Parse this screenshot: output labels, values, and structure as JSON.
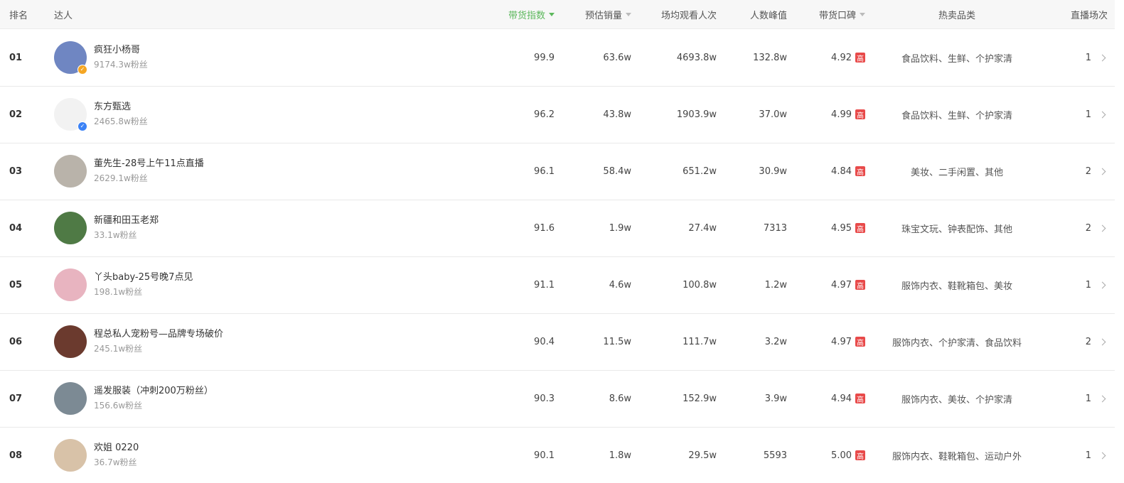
{
  "header": {
    "rank": "排名",
    "talent": "达人",
    "index": "带货指数",
    "sales": "预估销量",
    "views": "场均观看人次",
    "peak": "人数峰值",
    "reputation": "带货口碑",
    "categories": "热卖品类",
    "sessions": "直播场次"
  },
  "high_label": "高",
  "rows": [
    {
      "rank": "01",
      "name": "疯狂小杨哥",
      "fans": "9174.3w粉丝",
      "index": "99.9",
      "sales": "63.6w",
      "views": "4693.8w",
      "peak": "132.8w",
      "reputation": "4.92",
      "categories": "食品饮料、生鲜、个护家清",
      "sessions": "1",
      "avatar_color": "#6f86c2",
      "badge_color": "#f5a623"
    },
    {
      "rank": "02",
      "name": "东方甄选",
      "fans": "2465.8w粉丝",
      "index": "96.2",
      "sales": "43.8w",
      "views": "1903.9w",
      "peak": "37.0w",
      "reputation": "4.99",
      "categories": "食品饮料、生鲜、个护家清",
      "sessions": "1",
      "avatar_color": "#f2f2f2",
      "badge_color": "#3b82f6"
    },
    {
      "rank": "03",
      "name": "董先生-28号上午11点直播",
      "fans": "2629.1w粉丝",
      "index": "96.1",
      "sales": "58.4w",
      "views": "651.2w",
      "peak": "30.9w",
      "reputation": "4.84",
      "categories": "美妆、二手闲置、其他",
      "sessions": "2",
      "avatar_color": "#b9b3aa",
      "badge_color": ""
    },
    {
      "rank": "04",
      "name": "新疆和田玉老郑",
      "fans": "33.1w粉丝",
      "index": "91.6",
      "sales": "1.9w",
      "views": "27.4w",
      "peak": "7313",
      "reputation": "4.95",
      "categories": "珠宝文玩、钟表配饰、其他",
      "sessions": "2",
      "avatar_color": "#4f7a45",
      "badge_color": ""
    },
    {
      "rank": "05",
      "name": "丫头baby-25号晚7点见",
      "fans": "198.1w粉丝",
      "index": "91.1",
      "sales": "4.6w",
      "views": "100.8w",
      "peak": "1.2w",
      "reputation": "4.97",
      "categories": "服饰内衣、鞋靴箱包、美妆",
      "sessions": "1",
      "avatar_color": "#e8b4c0",
      "badge_color": ""
    },
    {
      "rank": "06",
      "name": "程总私人宠粉号—品牌专场破价",
      "fans": "245.1w粉丝",
      "index": "90.4",
      "sales": "11.5w",
      "views": "111.7w",
      "peak": "3.2w",
      "reputation": "4.97",
      "categories": "服饰内衣、个护家清、食品饮料",
      "sessions": "2",
      "avatar_color": "#6b3a2e",
      "badge_color": ""
    },
    {
      "rank": "07",
      "name": "遥发服装（冲刺200万粉丝）",
      "fans": "156.6w粉丝",
      "index": "90.3",
      "sales": "8.6w",
      "views": "152.9w",
      "peak": "3.9w",
      "reputation": "4.94",
      "categories": "服饰内衣、美妆、个护家清",
      "sessions": "1",
      "avatar_color": "#7c8a94",
      "badge_color": ""
    },
    {
      "rank": "08",
      "name": "欢姐 0220",
      "fans": "36.7w粉丝",
      "index": "90.1",
      "sales": "1.8w",
      "views": "29.5w",
      "peak": "5593",
      "reputation": "5.00",
      "categories": "服饰内衣、鞋靴箱包、运动户外",
      "sessions": "1",
      "avatar_color": "#d8c2a8",
      "badge_color": ""
    }
  ],
  "colors": {
    "accent_green": "#5cb85c",
    "high_red": "#e84a4a"
  }
}
